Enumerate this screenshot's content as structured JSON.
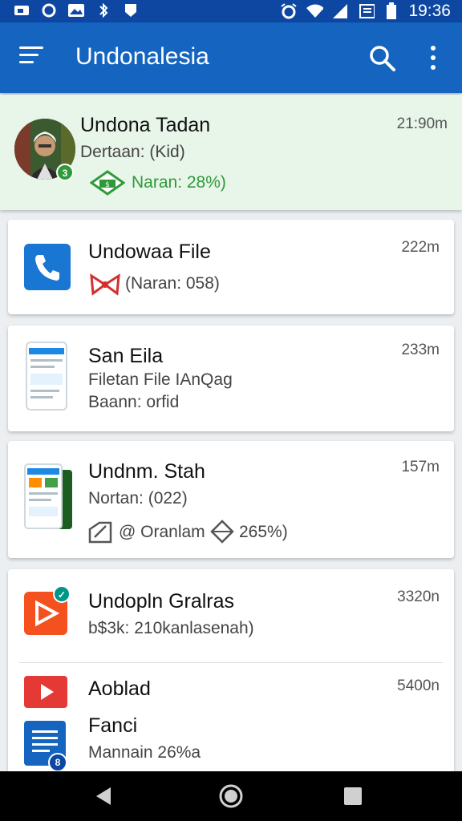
{
  "status_bar": {
    "time": "19:36",
    "left_icons": [
      "sim-icon",
      "circle-icon",
      "photo-icon",
      "bluetooth-icon",
      "shield-icon"
    ],
    "right_icons": [
      "alarm-icon",
      "wifi-icon",
      "signal-icon",
      "vibrate-icon",
      "battery-icon"
    ]
  },
  "app_bar": {
    "title": "Undonalesia"
  },
  "items": [
    {
      "title": "Undona Tadan",
      "line1": "Dertaan: (Kid)",
      "line2": "Naran: 28%)",
      "time": "21:90m",
      "badge": "3"
    },
    {
      "title": "Undowaa File",
      "line1": "(Naran: 058)",
      "time": "222m"
    },
    {
      "title": "San Eila",
      "line1": "Filetan File IAnQag",
      "line2": "Baann: orfid",
      "time": "233m"
    },
    {
      "title": "Undnm. Stah",
      "line1": "Nortan: (022)",
      "line2a": "@ Oranlam",
      "line2b": "265%)",
      "time": "157m"
    },
    {
      "title": "Undopln Gralras",
      "line1": "b$3k: 210kanlasenah)",
      "time": "3320n"
    },
    {
      "title": "Aoblad",
      "line1": "Fanci",
      "line2": "Mannain 26%a",
      "time": "5400n",
      "badge": "8"
    }
  ],
  "colors": {
    "status_bar": "#0d47a1",
    "app_bar": "#1565c0",
    "highlight_row": "#e8f5e9",
    "accent_green": "#2e9a3a"
  }
}
